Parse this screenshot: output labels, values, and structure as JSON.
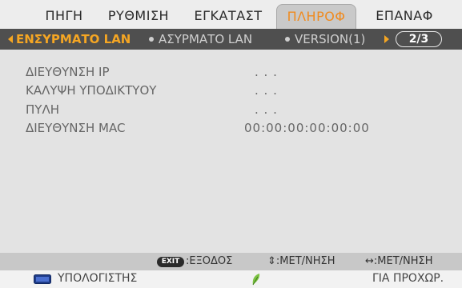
{
  "menu": {
    "tabs": [
      {
        "label": "ΠΗΓΗ",
        "active": false
      },
      {
        "label": "ΡΥΘΜΙΣΗ",
        "active": false
      },
      {
        "label": "ΕΓΚΑΤΑΣΤ",
        "active": false
      },
      {
        "label": "ΠΛΗΡΟΦ",
        "active": true
      },
      {
        "label": "ΕΠΑΝΑΦ",
        "active": false
      }
    ],
    "subtabs": [
      {
        "label": "ΕΝΣΥΡΜΑΤΟ LAN",
        "active": true
      },
      {
        "label": "ΑΣΥΡΜΑΤΟ LAN",
        "active": false
      },
      {
        "label": "VERSION(1)",
        "active": false
      }
    ],
    "page_indicator": "2/3",
    "accent_color": "#f5a623"
  },
  "info": {
    "rows": [
      {
        "label": "ΔΙΕΥΘΥΝΣΗ IP",
        "value": ". . ."
      },
      {
        "label": "ΚΑΛΥΨΗ ΥΠΟΔΙΚΤΥΟΥ",
        "value": ". . ."
      },
      {
        "label": "ΠΥΛΗ",
        "value": ". . ."
      },
      {
        "label": "ΔΙΕΥΘΥΝΣΗ MAC",
        "value": "00:00:00:00:00:00"
      }
    ]
  },
  "help": {
    "exit_badge": "EXIT",
    "exit_label": ":ΕΞΟΔΟΣ",
    "move_label": "⇕:ΜΕΤ/ΝΗΣΗ",
    "lr_label": "↔:ΜΕΤ/ΝΗΣΗ"
  },
  "status": {
    "source_icon": "monitor-icon",
    "source_label": "ΥΠΟΛΟΓΙΣΤΗΣ",
    "eco_icon": "leaf-icon",
    "mode_label": "ΓΙΑ ΠΡΟΧΩΡ."
  }
}
